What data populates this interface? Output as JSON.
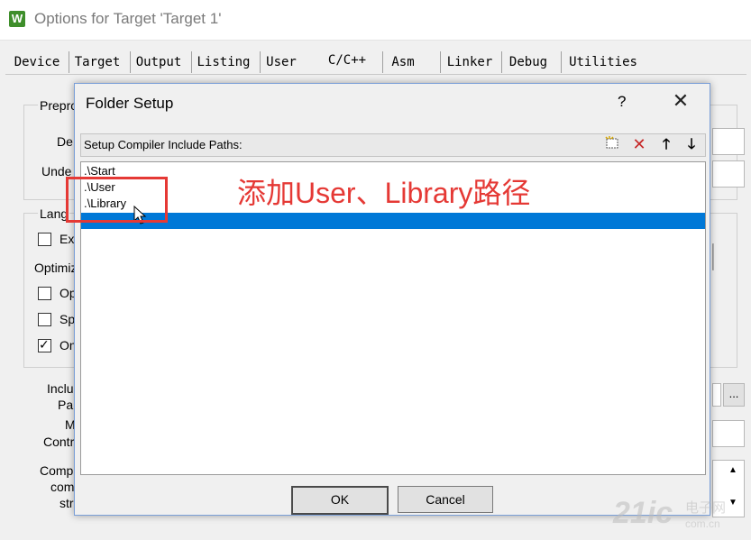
{
  "window": {
    "title": "Options for Target 'Target 1'",
    "icon": "keil-icon"
  },
  "tabs": [
    {
      "label": "Device",
      "active": false
    },
    {
      "label": "Target",
      "active": false
    },
    {
      "label": "Output",
      "active": false
    },
    {
      "label": "Listing",
      "active": false
    },
    {
      "label": "User",
      "active": false
    },
    {
      "label": "C/C++",
      "active": true
    },
    {
      "label": "Asm",
      "active": false
    },
    {
      "label": "Linker",
      "active": false
    },
    {
      "label": "Debug",
      "active": false
    },
    {
      "label": "Utilities",
      "active": false
    }
  ],
  "panel": {
    "labels": [
      "Prepro",
      "De",
      "Unde",
      "Lang",
      "Ex",
      "Optimiz",
      "Op",
      "Sp",
      "On",
      "Inclu",
      "Pa",
      "M",
      "Contr",
      "Comp",
      "com",
      "str",
      "..."
    ],
    "checkboxes": [
      {
        "label": "Ex",
        "checked": false
      },
      {
        "label": "Op",
        "checked": false
      },
      {
        "label": "Sp",
        "checked": false
      },
      {
        "label": "On",
        "checked": true
      }
    ]
  },
  "dialog": {
    "title": "Folder Setup",
    "help": "?",
    "close": "✕",
    "list_header": "Setup Compiler Include Paths:",
    "toolbar": [
      "new-folder-icon",
      "delete-icon",
      "move-up-icon",
      "move-down-icon"
    ],
    "items": [
      ".\\Start",
      ".\\User",
      ".\\Library"
    ],
    "ok_label": "OK",
    "cancel_label": "Cancel"
  },
  "annotation": {
    "text": "添加User、Library路径",
    "color": "#e53935"
  },
  "watermark": {
    "main": "21ic",
    "sub": "电子网",
    "domain": "com.cn"
  },
  "colors": {
    "selection": "#0078d7",
    "annotation": "#e53935"
  }
}
